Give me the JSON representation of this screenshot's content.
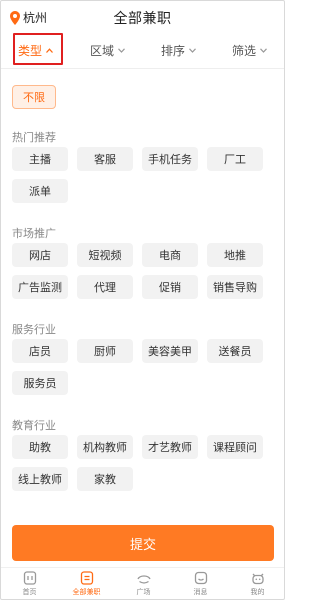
{
  "header": {
    "city": "杭州",
    "title": "全部兼职"
  },
  "filters": [
    {
      "label": "类型",
      "active": true
    },
    {
      "label": "区域",
      "active": false
    },
    {
      "label": "排序",
      "active": false
    },
    {
      "label": "筛选",
      "active": false
    }
  ],
  "unlimited_label": "不限",
  "sections": {
    "hot": {
      "title": "热门推荐",
      "items": [
        "主播",
        "客服",
        "手机任务",
        "厂工",
        "派单"
      ]
    },
    "market": {
      "title": "市场推广",
      "items": [
        "网店",
        "短视频",
        "电商",
        "地推",
        "广告监测",
        "代理",
        "促销",
        "销售导购"
      ]
    },
    "service": {
      "title": "服务行业",
      "items": [
        "店员",
        "厨师",
        "美容美甲",
        "送餐员",
        "服务员"
      ]
    },
    "education": {
      "title": "教育行业",
      "items": [
        "助教",
        "机构教师",
        "才艺教师",
        "课程顾问",
        "线上教师",
        "家教"
      ]
    }
  },
  "submit_label": "提交",
  "tabs": [
    {
      "label": "首页",
      "icon": "home-icon",
      "active": false
    },
    {
      "label": "全部兼职",
      "icon": "list-icon",
      "active": true
    },
    {
      "label": "广场",
      "icon": "plaza-icon",
      "active": false
    },
    {
      "label": "消息",
      "icon": "message-icon",
      "active": false
    },
    {
      "label": "我的",
      "icon": "profile-icon",
      "active": false
    }
  ],
  "colors": {
    "accent": "#ff6a13",
    "highlight_border": "#e02020",
    "submit": "#ff7a23",
    "chip_bg": "#f2f2f2"
  }
}
